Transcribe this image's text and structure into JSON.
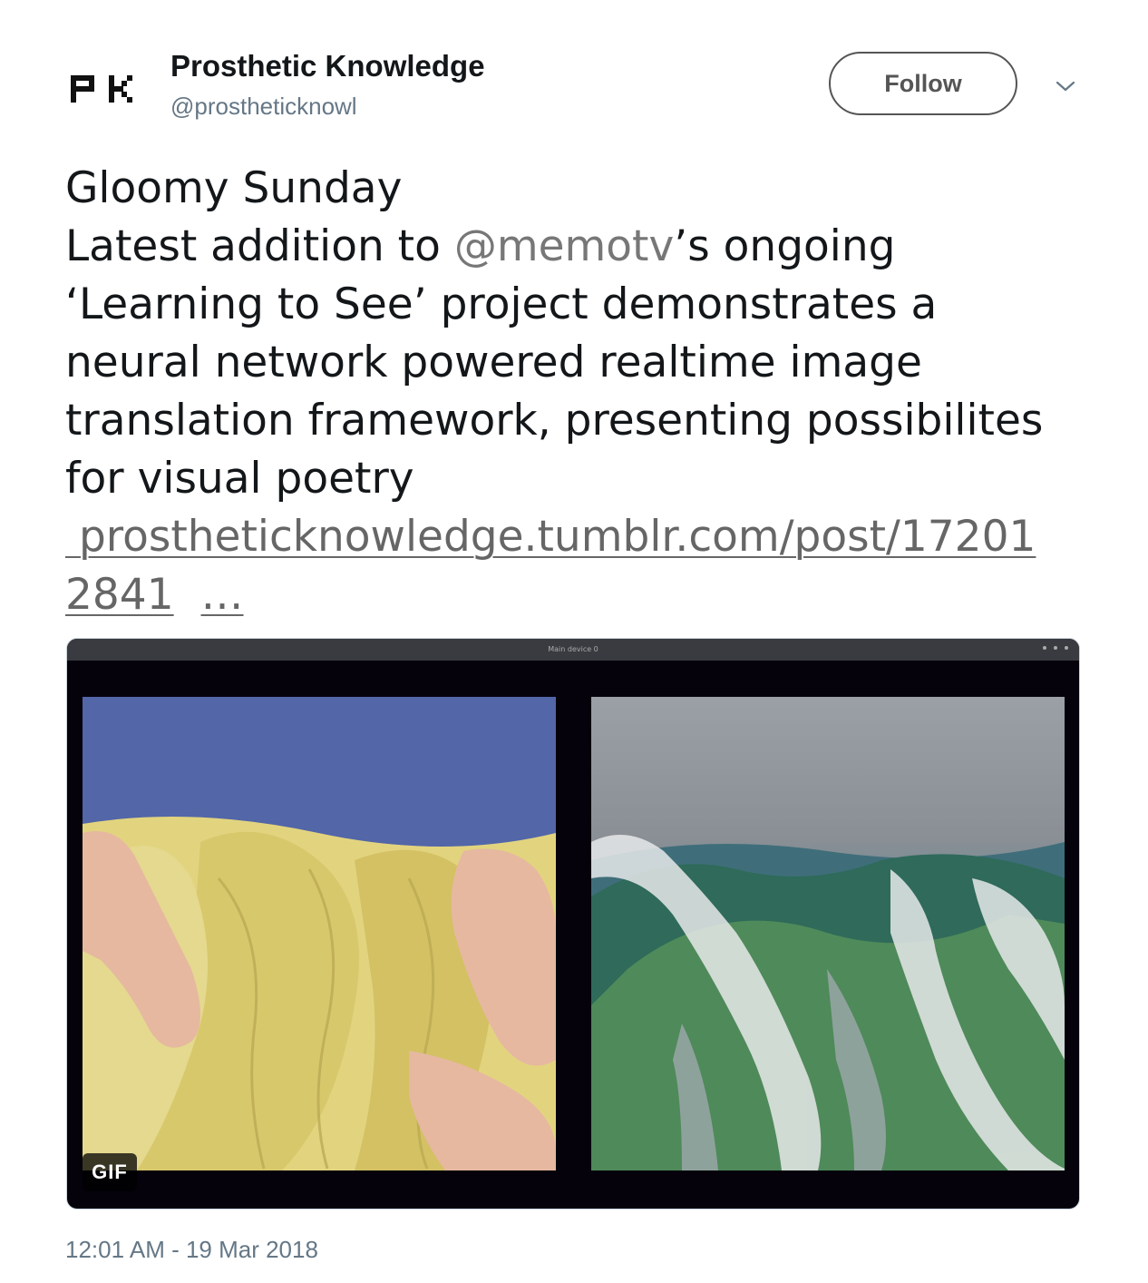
{
  "author": {
    "avatar_text": "PK",
    "name": "Prosthetic Knowledge",
    "handle": "@prostheticknowl"
  },
  "actions": {
    "follow_label": "Follow",
    "menu_icon": "chevron-down-icon"
  },
  "tweet": {
    "line1": "Gloomy Sunday",
    "line2_prefix": "Latest addition to ",
    "mention": "@memotv",
    "line2_suffix": "’s ongoing",
    "body": "‘Learning to See’ project demonstrates a\nneural network powered realtime image\ntranslation framework, presenting possibilites\nfor visual poetry",
    "link_part1": "prostheticknowledge.tumblr.com/post/17201",
    "link_part2": "2841",
    "link_ellipsis": "…"
  },
  "media": {
    "window_title": "Main device 0",
    "badge": "GIF"
  },
  "timestamp": "12:01 AM - 19 Mar 2018",
  "colors": {
    "text": "#14171a",
    "secondary": "#657786",
    "border": "#555555"
  }
}
